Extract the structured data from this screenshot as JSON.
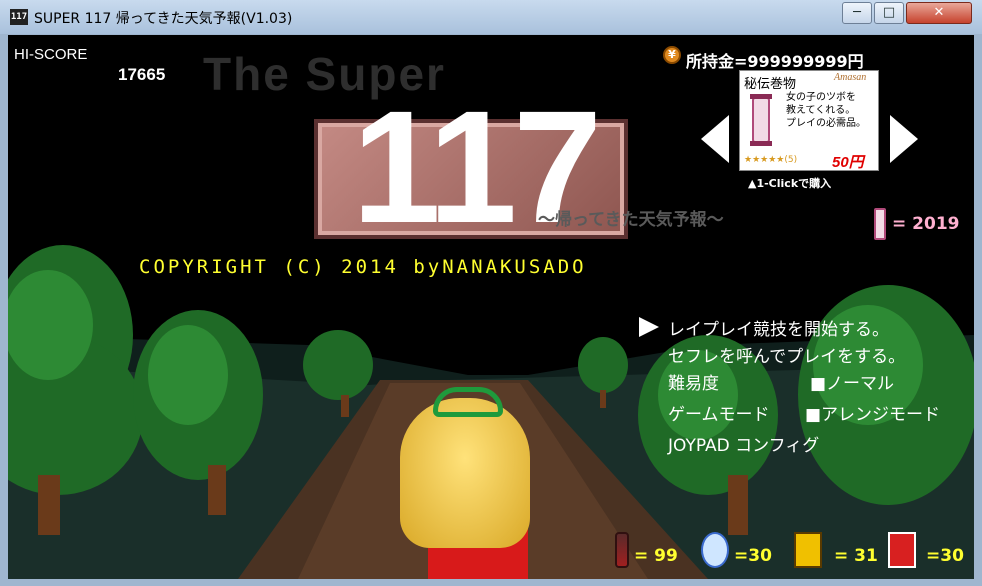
{
  "window": {
    "title": "SUPER 117 帰ってきた天気予報(V1.03)",
    "app_icon": "117",
    "min_label": "─",
    "max_label": "□",
    "close_label": "✕"
  },
  "hud": {
    "hi_score_label": "HI-SCORE",
    "hi_score_value": "17665",
    "money_label": "所持金=999999999円",
    "money_icon": "¥"
  },
  "logo": {
    "super_text": "The Super",
    "number": "117",
    "subtitle": "〜帰ってきた天気予報〜"
  },
  "copyright": "COPYRIGHT (C) 2014 byNANAKUSADO",
  "shop": {
    "item_name": "秘伝巻物",
    "brand": "Amasan",
    "description_lines": [
      "女の子のツボを",
      "教えてくれる。",
      "プレイの必需品。"
    ],
    "rating": "★★★★★(5)",
    "price": "50円",
    "one_click": "▲1-Clickで購入",
    "scroll_count": "= 2019"
  },
  "menu": {
    "items": [
      {
        "label": "レイプレイ競技を開始する。"
      },
      {
        "label": "セフレを呼んでプレイをする。"
      },
      {
        "label": "難易度",
        "value": "■ノーマル"
      },
      {
        "label": "ゲームモード",
        "value": "■アレンジモード"
      },
      {
        "label": "JOYPAD コンフィグ"
      }
    ]
  },
  "inventory": [
    {
      "icon": "bottle-icon",
      "value": "= 99"
    },
    {
      "icon": "wing-icon",
      "value": "=30"
    },
    {
      "icon": "rapid-icon",
      "value": "= 31"
    },
    {
      "icon": "ghost-icon",
      "value": "=30"
    }
  ],
  "colors": {
    "accent": "#ffff30",
    "background": "#000000"
  }
}
